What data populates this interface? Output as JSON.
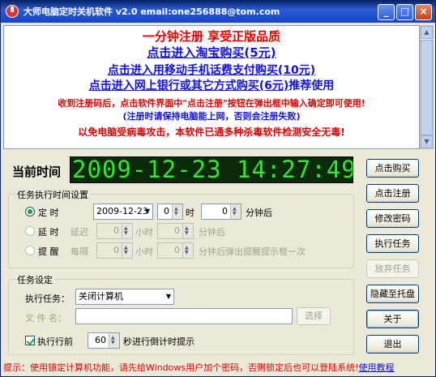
{
  "window": {
    "title": "大师电脑定时关机软件 v2.0 email:one256888@tom.com",
    "buttons": {
      "minimize": "_",
      "maximize": "□",
      "close": "×"
    }
  },
  "banner": {
    "line1": "一分钟注册 享受正版品质",
    "line2": "点击进入淘宝购买(5元)",
    "line3": "点击进入用移动手机话费支付购买(10元)",
    "line4_link": "点击进入网上银行或其它方式购买(6元)",
    "line4_suffix": "推荐使用",
    "line5": "收到注册码后，点击软件界面中\"点击注册\"按钮在弹出框中输入确定即可使用!",
    "line6": "(注册时请保持电脑能上网，否则会注册失败)",
    "line7": "以免电脑受病毒攻击，本软件已通多种杀毒软件检测安全无毒!"
  },
  "clock": {
    "label": "当前时间",
    "value": "2009-12-23 14:27:49"
  },
  "schedule": {
    "group_label": "任务执行时间设置",
    "timed": {
      "label": "定 时",
      "date": "2009-12-23",
      "hour": "0",
      "hour_unit": "时",
      "minute": "0",
      "minute_unit": "分钟后"
    },
    "delay": {
      "label": "延 时",
      "prefix": "延迟",
      "hour": "0",
      "hour_unit": "小时",
      "minute": "0",
      "minute_unit": "分钟后"
    },
    "remind": {
      "label": "提 醒",
      "prefix": "每隔",
      "hour": "0",
      "hour_unit": "小时",
      "minute": "0",
      "minute_unit": "分钟后弹出提醒提示框一次"
    }
  },
  "task": {
    "group_label": "任务设定",
    "exec_label": "执行任务：",
    "exec_value": "关闭计算机",
    "file_label": "文 件 名：",
    "file_value": "",
    "browse_label": "选择",
    "countdown_check_label": "执行行前",
    "countdown_value": "60",
    "countdown_suffix": "秒进行倒计时提示"
  },
  "side_buttons": {
    "buy": "点击购买",
    "register": "点击注册",
    "change_password": "修改密码",
    "execute": "执行任务",
    "abandon": "放弃任务",
    "hide_tray": "隐藏至托盘",
    "about": "关于",
    "exit": "退出"
  },
  "status": {
    "prefix": "提示：使用锁定计算机功能，请先给Windows用户加个密码，否则锁定后也可以登陆系统!",
    "link": "使用教程"
  }
}
